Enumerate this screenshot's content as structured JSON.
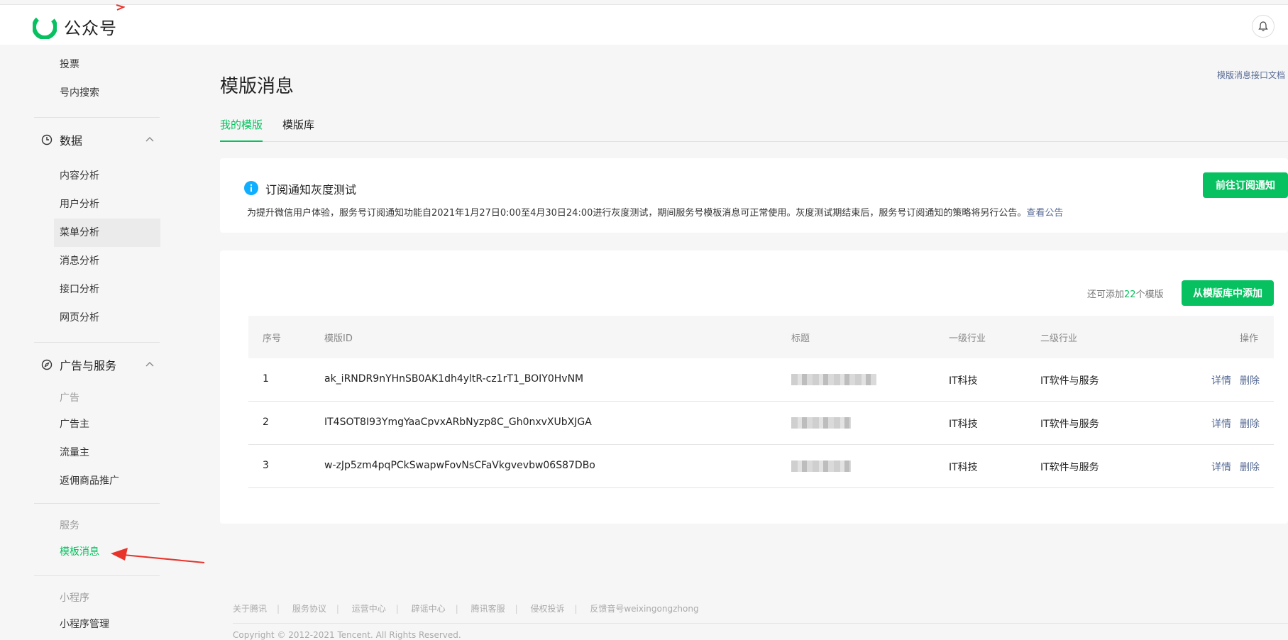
{
  "header": {
    "logo_text": "公众号"
  },
  "sidebar": {
    "group_top": [
      {
        "label": "投票"
      },
      {
        "label": "号内搜索"
      }
    ],
    "data_section": {
      "label": "数据",
      "items": [
        {
          "label": "内容分析"
        },
        {
          "label": "用户分析"
        },
        {
          "label": "菜单分析"
        },
        {
          "label": "消息分析"
        },
        {
          "label": "接口分析"
        },
        {
          "label": "网页分析"
        }
      ]
    },
    "ad_section": {
      "label": "广告与服务",
      "ad_sub": "广告",
      "ad_items": [
        {
          "label": "广告主"
        },
        {
          "label": "流量主"
        },
        {
          "label": "返佣商品推广"
        }
      ],
      "service_sub": "服务",
      "service_items": [
        {
          "label": "模板消息"
        }
      ],
      "mini_sub": "小程序",
      "mini_items": [
        {
          "label": "小程序管理"
        }
      ]
    }
  },
  "main": {
    "title": "模版消息",
    "doc_link": "模版消息接口文档",
    "tabs": [
      {
        "label": "我的模版"
      },
      {
        "label": "模版库"
      }
    ],
    "notice": {
      "title": "订阅通知灰度测试",
      "body": "为提升微信用户体验，服务号订阅通知功能自2021年1月27日0:00至4月30日24:00进行灰度测试，期间服务号模板消息可正常使用。灰度测试期结束后，服务号订阅通知的策略将另行公告。",
      "link": "查看公告",
      "button": "前往订阅通知"
    },
    "templates": {
      "quota_prefix": "还可添加",
      "quota_num": "22",
      "quota_suffix": "个模版",
      "add_button": "从模版库中添加",
      "columns": [
        "序号",
        "模版ID",
        "标题",
        "一级行业",
        "二级行业",
        "操作"
      ],
      "rows": [
        {
          "no": "1",
          "id": "ak_iRNDR9nYHnSB0AK1dh4yltR-cz1rT1_BOIY0HvNM",
          "industry1": "IT科技",
          "industry2": "IT软件与服务",
          "detail": "详情",
          "delete": "删除"
        },
        {
          "no": "2",
          "id": "IT4SOT8I93YmgYaaCpvxARbNyzp8C_Gh0nxvXUbXJGA",
          "industry1": "IT科技",
          "industry2": "IT软件与服务",
          "detail": "详情",
          "delete": "删除"
        },
        {
          "no": "3",
          "id": "w-zJp5zm4pqPCkSwapwFovNsCFaVkgvevbw06S87DBo",
          "industry1": "IT科技",
          "industry2": "IT软件与服务",
          "detail": "详情",
          "delete": "删除"
        }
      ]
    }
  },
  "footer": {
    "links": [
      "关于腾讯",
      "服务协议",
      "运营中心",
      "辟谣中心",
      "腾讯客服",
      "侵权投诉",
      "反馈音号weixingongzhong"
    ],
    "copyright": "Copyright © 2012-2021 Tencent. All Rights Reserved."
  },
  "icons": {
    "logo": "wechat-official-account-logo",
    "bell": "bell-icon",
    "data": "clock-icon",
    "ad": "compass-icon",
    "chevron": "chevron-up-icon",
    "info": "info-icon"
  },
  "colors": {
    "accent": "#07c160",
    "link": "#576b95",
    "annotation": "#e8332b"
  }
}
